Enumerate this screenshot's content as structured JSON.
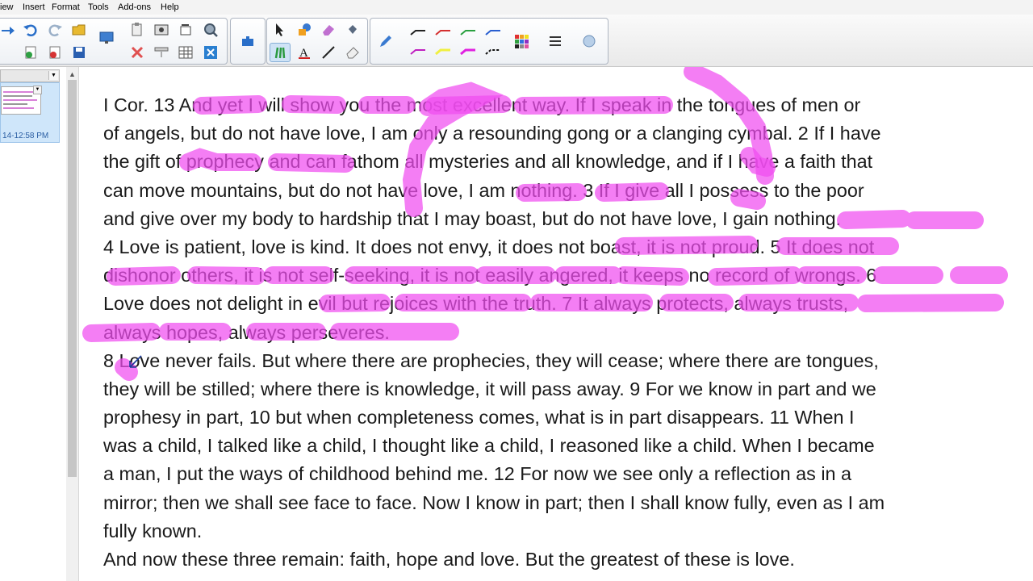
{
  "menu": [
    "iew",
    "Insert",
    "Format",
    "Tools",
    "Add-ons",
    "Help"
  ],
  "colors": {
    "highlight": "#f04cf0",
    "selection": "#cfe3f6",
    "thumb_time": "#2b5ea3"
  },
  "toolbar": {
    "group1_icons": [
      "arrow-icon",
      "undo-icon",
      "redo-icon",
      "open-folder-icon",
      "display-icon",
      "paste-icon",
      "screen-capture-icon",
      "rotate-icon",
      "gear-search-icon",
      "add-page-icon",
      "delete-page-icon",
      "save-icon",
      "delete-icon",
      "screen-shade-icon",
      "table-icon",
      "close-box-icon"
    ],
    "group2_icons": [
      "add-ons-puzzle-icon"
    ],
    "group3_icons": [
      "select-icon",
      "shapes-icon",
      "eraser-icon",
      "fill-icon",
      "pens-icon",
      "text-icon",
      "line-icon",
      "eraser-tool-icon"
    ],
    "group4_icons": [
      "pen-icon",
      "line-style-icon",
      "color-palette-icon",
      "properties-icon",
      "magic-pen-icon"
    ]
  },
  "sidebar": {
    "thumb_time": "14-12:58 PM"
  },
  "document": {
    "lines": [
      "I Cor. 13  And yet I will show you the most excellent way.  If I speak in the tongues of men or",
      "of angels, but do not have love, I am only a resounding gong or a clanging cymbal. 2 If I have",
      "the gift of prophecy and can fathom all mysteries and all knowledge, and if I have a faith that",
      "can move mountains, but do not have love, I am nothing. 3 If I give all I possess to the poor",
      "and give over my body to hardship that I may boast, but do not have love, I gain nothing.",
      "4 Love is patient, love is kind. It does not envy, it does not boast, it is not proud. 5 It does not",
      "dishonor others, it is not self-seeking, it is not easily angered, it keeps no record of wrongs. 6",
      "Love does not delight in evil but rejoices with the truth. 7 It always protects, always trusts,",
      "always hopes, always perseveres.",
      "8 Love never fails. But where there are prophecies, they will cease; where there are tongues,",
      "they will be stilled; where there is knowledge, it will pass away. 9 For we know in part and we",
      "prophesy in part, 10 but when completeness comes, what is in part disappears. 11 When I",
      "was a child, I talked like a child, I thought like a child, I reasoned like a child. When I became",
      "a man, I put the ways of childhood behind me. 12 For now we see only a reflection as in a",
      "mirror; then we shall see face to face. Now I know in part; then I shall know fully, even as I am",
      "fully known.",
      "And now these three remain: faith, hope and love. But the greatest of these is love."
    ]
  }
}
